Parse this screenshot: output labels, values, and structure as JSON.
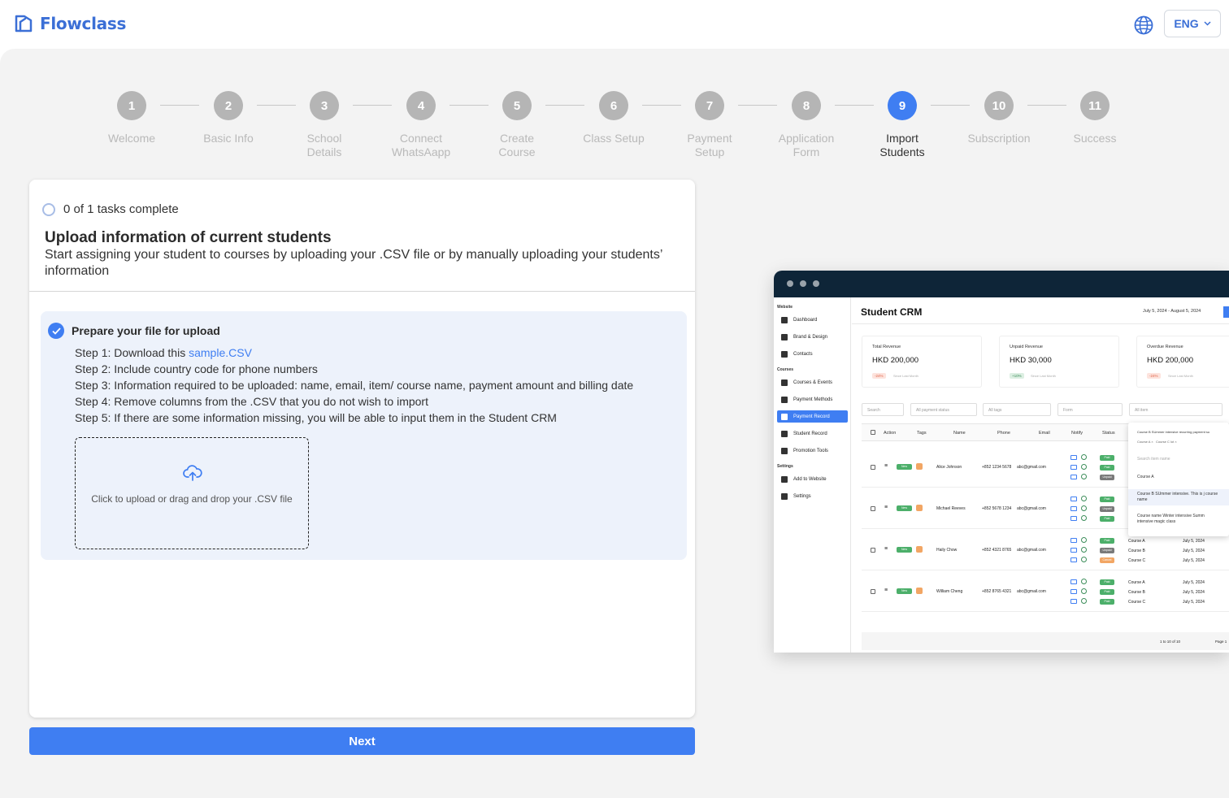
{
  "brand": {
    "name": "Flowclass"
  },
  "header": {
    "language": "ENG"
  },
  "stepper": {
    "steps": [
      {
        "num": "1",
        "label": "Welcome"
      },
      {
        "num": "2",
        "label": "Basic Info"
      },
      {
        "num": "3",
        "label": "School\nDetails"
      },
      {
        "num": "4",
        "label": "Connect\nWhatsAapp"
      },
      {
        "num": "5",
        "label": "Create\nCourse"
      },
      {
        "num": "6",
        "label": "Class Setup"
      },
      {
        "num": "7",
        "label": "Payment\nSetup"
      },
      {
        "num": "8",
        "label": "Application\nForm"
      },
      {
        "num": "9",
        "label": "Import\nStudents"
      },
      {
        "num": "10",
        "label": "Subscription"
      },
      {
        "num": "11",
        "label": "Success"
      }
    ],
    "active_step": 9
  },
  "card": {
    "tasks_status": "0 of 1 tasks complete",
    "title": "Upload information of current students",
    "subtitle": "Start assigning your student to courses by uploading your .CSV file or by manually uploading your students’ information",
    "panel": {
      "heading": "Prepare your file for upload",
      "step1_prefix": "Step 1: Download this ",
      "step1_link": "sample.CSV",
      "step2": "Step 2: Include country code for phone numbers",
      "step3": "Step 3: Information required to be uploaded: name, email, item/ course name, payment amount and billing date",
      "step4": "Step 4: Remove columns from the .CSV that you do not wish to import",
      "step5": "Step 5: If there are some information missing, you will be able to input them in the Student CRM",
      "dropzone_text": "Click to upload or drag and drop your .CSV file"
    }
  },
  "next_button": "Next",
  "preview": {
    "title": "Student CRM",
    "date_range": "July 5, 2024 - August 5, 2024",
    "sidebar": {
      "section_website": "Website",
      "section_courses": "Courses",
      "section_settings": "Settings",
      "items": [
        "Dashboard",
        "Brand & Design",
        "Contacts",
        "Courses & Events",
        "Payment Methods",
        "Payment Record",
        "Student Record",
        "Promotion Tools",
        "Add to Website",
        "Settings"
      ]
    },
    "stats": [
      {
        "label": "Total Revenue",
        "value": "HKD 200,000",
        "pct": "-24%",
        "compare": "Since Last Month"
      },
      {
        "label": "Unpaid Revenue",
        "value": "HKD 30,000",
        "pct": "+10%",
        "compare": "Since Last Month"
      },
      {
        "label": "Overdue Revenue",
        "value": "HKD 200,000",
        "pct": "-24%",
        "compare": "Since Last Month"
      }
    ],
    "filters": [
      "Search",
      "All payment status",
      "All tags",
      "Form",
      "All item"
    ],
    "columns": [
      "Action",
      "Tags",
      "Name",
      "Phone",
      "Email",
      "Notify",
      "Status"
    ],
    "rows": [
      {
        "name": "Alice Johnson",
        "phone": "+852 1234 5678",
        "email": "abc@gmail.com",
        "statuses": [
          "Paid",
          "Paid",
          "Unpaid"
        ]
      },
      {
        "name": "Michael Reeves",
        "phone": "+852 5678 1234",
        "email": "abc@gmail.com",
        "statuses": [
          "Paid",
          "Unpaid",
          "Paid"
        ]
      },
      {
        "name": "Haily Chow",
        "phone": "+852 4321 8765",
        "email": "abc@gmail.com",
        "statuses": [
          "Paid",
          "Unpaid",
          "Cancel"
        ]
      },
      {
        "name": "William Cheng",
        "phone": "+852 8765 4321",
        "email": "abc@gmail.com",
        "statuses": [
          "Paid",
          "Paid",
          "Paid"
        ]
      }
    ],
    "tag_new": "New",
    "course_rows": [
      {
        "course": "Course A",
        "date": "July 5, 2024"
      },
      {
        "course": "Course B",
        "date": "July 5, 2024"
      },
      {
        "course": "Course C",
        "date": "July 5, 2024"
      }
    ],
    "dropdown": {
      "selected_text": "Course B SUmmer intensive recurring payment su",
      "chips": [
        "Course A",
        "Course C lot"
      ],
      "search_placeholder": "Search item name",
      "options": [
        "Course A",
        "Course B SUmmer intensive. This is j course name",
        "Course name Winter intensive Summ intensive magic class"
      ]
    },
    "pagination": "1 to 10 of 10",
    "page_label": "Page 1"
  }
}
